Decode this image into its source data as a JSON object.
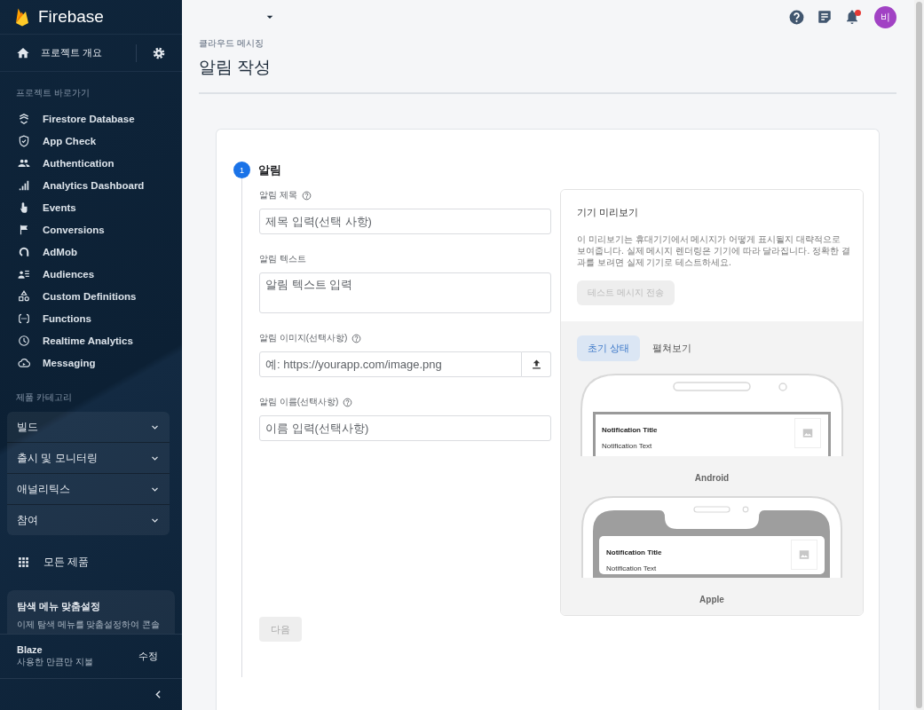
{
  "sidebar": {
    "brand": "Firebase",
    "overview": "프로젝트 개요",
    "shortcuts_heading": "프로젝트 바로가기",
    "shortcuts": [
      {
        "label": "Firestore Database"
      },
      {
        "label": "App Check"
      },
      {
        "label": "Authentication"
      },
      {
        "label": "Analytics Dashboard"
      },
      {
        "label": "Events"
      },
      {
        "label": "Conversions"
      },
      {
        "label": "AdMob"
      },
      {
        "label": "Audiences"
      },
      {
        "label": "Custom Definitions"
      },
      {
        "label": "Functions"
      },
      {
        "label": "Realtime Analytics"
      },
      {
        "label": "Messaging"
      }
    ],
    "categories_heading": "제품 카테고리",
    "categories": [
      {
        "label": "빌드",
        "expanded": false
      },
      {
        "label": "출시 및 모니터링",
        "expanded": false
      },
      {
        "label": "애널리틱스",
        "expanded": false
      },
      {
        "label": "참여",
        "expanded": false
      }
    ],
    "all_products": "모든 제품",
    "customize_card": {
      "title": "탐색 메뉴 맞춤설정",
      "text": "이제 탐색 메뉴를 맞춤설정하여 콘솔"
    },
    "plan": {
      "name": "Blaze",
      "description": "사용한 만큼만 지불",
      "action": "수정"
    }
  },
  "topbar": {
    "avatar": "비",
    "has_alert": true
  },
  "header": {
    "breadcrumb": "클라우드 메시징",
    "title": "알림 작성"
  },
  "step": {
    "number": "1",
    "title": "알림",
    "fields": [
      {
        "kind": "input",
        "label": "알림 제목",
        "help": true,
        "placeholder": "제목 입력(선택 사항)"
      },
      {
        "kind": "textarea",
        "label": "알림 텍스트",
        "help": false,
        "placeholder": "알림 텍스트 입력"
      },
      {
        "kind": "upload",
        "label": "알림 이미지(선택사항)",
        "help": true,
        "placeholder": "예: https://yourapp.com/image.png"
      },
      {
        "kind": "input",
        "label": "알림 이름(선택사항)",
        "help": true,
        "placeholder": "이름 입력(선택사항)"
      }
    ],
    "next_button": {
      "label": "다음",
      "disabled": true
    }
  },
  "preview": {
    "title": "기기 미리보기",
    "description": "이 미리보기는 휴대기기에서 메시지가 어떻게 표시될지 대략적으로 보여줍니다. 실제 메시지 렌더링은 기기에 따라 달라집니다. 정확한 결과를 보려면 실제 기기로 테스트하세요.",
    "test_button": {
      "label": "테스트 메시지 전송",
      "disabled": true
    },
    "tabs": [
      {
        "label": "초기 상태",
        "selected": true
      },
      {
        "label": "펼쳐보기",
        "selected": false
      }
    ],
    "devices": [
      {
        "kind": "android",
        "name": "Android",
        "notification_title": "Notification Title",
        "notification_text": "Notification Text"
      },
      {
        "kind": "apple",
        "name": "Apple",
        "notification_title": "Notification Title",
        "notification_text": "Notification Text"
      }
    ]
  }
}
